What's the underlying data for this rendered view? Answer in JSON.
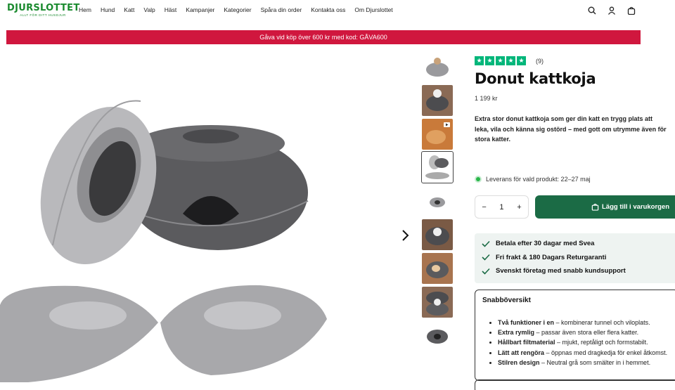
{
  "header": {
    "logo_main": "DJURSLOTTET",
    "logo_sub": "ALLT FÖR DITT HUSDJUR",
    "nav": [
      "Hem",
      "Hund",
      "Katt",
      "Valp",
      "Häst",
      "Kampanjer",
      "Kategorier",
      "Spåra din order",
      "Kontakta oss",
      "Om Djurslottet"
    ],
    "icons": [
      "search-icon",
      "user-icon",
      "bag-icon"
    ]
  },
  "banner": {
    "text": "Gåva vid köp över 600 kr med kod: GÅVA600"
  },
  "product": {
    "rating_count": "(9)",
    "rating_stars": 5,
    "title": "Donut kattkoja",
    "price": "1 199 kr",
    "description": "Extra stor donut kattkoja som ger din katt en trygg plats att leka, vila och känna sig ostörd – med gott om utrymme även för stora katter.",
    "delivery": "Leverans för vald produkt: 22–27 maj",
    "quantity": "1",
    "add_to_cart": "Lägg till i varukorgen"
  },
  "usps": [
    "Betala efter 30 dagar med Svea",
    "Fri frakt & 180 Dagars Returgaranti",
    "Svenskt företag med snabb kundsupport"
  ],
  "quick": {
    "title": "Snabböversikt",
    "items": [
      {
        "bold": "Två funktioner i en",
        "text": " – kombinerar tunnel och viloplats."
      },
      {
        "bold": "Extra rymlig",
        "text": " – passar även stora eller flera katter."
      },
      {
        "bold": "Hållbart filtmaterial",
        "text": " – mjukt, reptåligt och formstabilt."
      },
      {
        "bold": "Lätt att rengöra",
        "text": " – öppnas med dragkedja för enkel åtkomst."
      },
      {
        "bold": "Stilren design",
        "text": " – Neutral grå som smälter in i hemmet."
      }
    ]
  },
  "colors": {
    "brand_green": "#1a8a2e",
    "banner_red": "#d0173e",
    "button_green": "#1b6b45",
    "trustpilot": "#00b67a"
  }
}
